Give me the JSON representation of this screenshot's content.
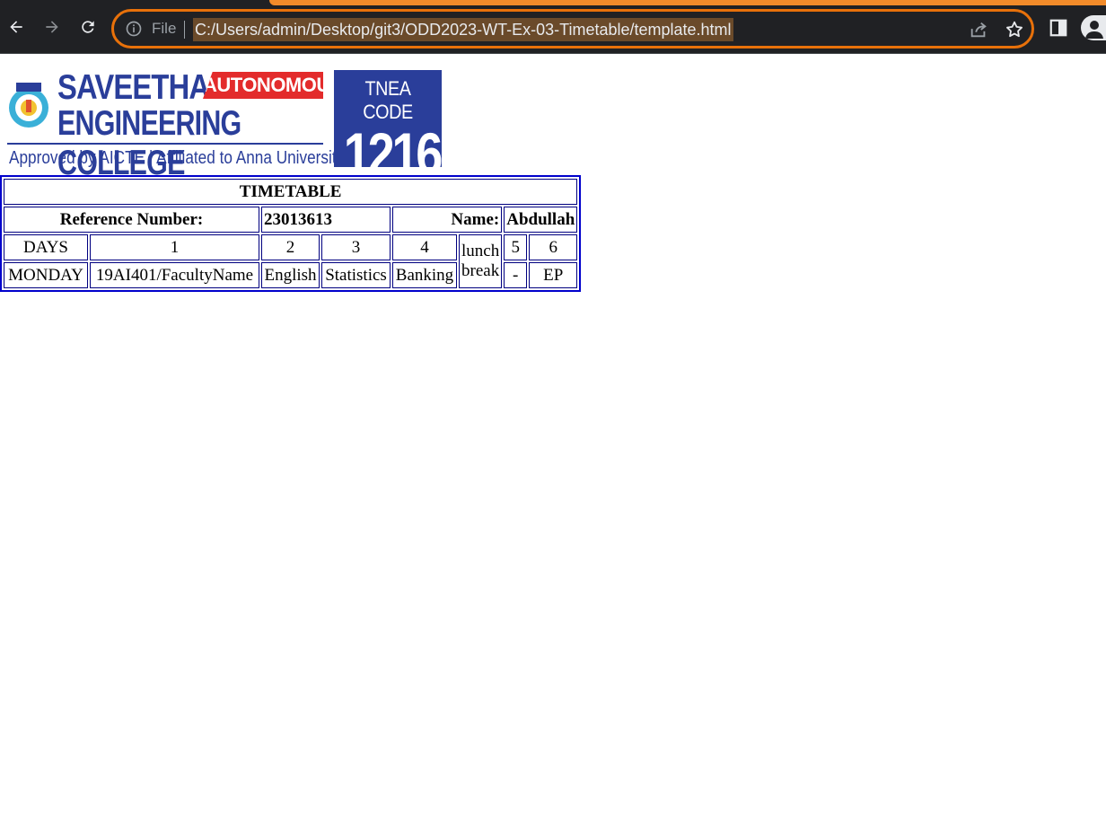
{
  "browser": {
    "file_label": "File",
    "url": "C:/Users/admin/Desktop/git3/ODD2023-WT-Ex-03-Timetable/template.html"
  },
  "logo": {
    "college_line1": "SAVEETHA",
    "badge": "AUTONOMOUS",
    "college_line2": "ENGINEERING COLLEGE",
    "approved": "Approved by AICTE  |  Affiliated to Anna University",
    "tnea_label": "TNEA CODE",
    "tnea_code": "1216"
  },
  "timetable": {
    "title": "TIMETABLE",
    "ref_label": "Reference Number:",
    "ref_value": "23013613",
    "name_label": "Name:",
    "name_value": "Abdullah",
    "header": {
      "days": "DAYS",
      "p1": "1",
      "p2": "2",
      "p3": "3",
      "p4": "4",
      "lunch_line1": "lunch",
      "lunch_line2": "break",
      "p5": "5",
      "p6": "6"
    },
    "monday": {
      "day": "MONDAY",
      "p1": "19AI401/FacultyName",
      "p2": "English",
      "p3": "Statistics",
      "p4": "Banking",
      "p5": "-",
      "p6": "EP"
    }
  }
}
